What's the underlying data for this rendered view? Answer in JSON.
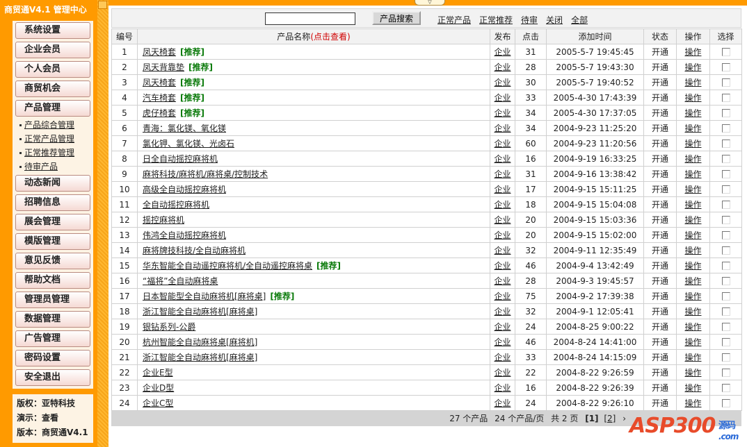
{
  "sidebar": {
    "title": "商贸通V4.1 管理中心",
    "menu": [
      "系统设置",
      "企业会员",
      "个人会员",
      "商贸机会",
      "产品管理"
    ],
    "submenu": [
      "产品综合管理",
      "正常产品管理",
      "正常推荐管理",
      "待审产品"
    ],
    "menu2": [
      "动态新闻",
      "招聘信息",
      "展会管理",
      "模版管理",
      "意见反馈",
      "帮助文档",
      "管理员管理",
      "数据管理",
      "广告管理",
      "密码设置",
      "安全退出"
    ],
    "info": [
      "版权：亚特科技",
      "演示：查看",
      "版本：商贸通V4.1"
    ]
  },
  "search": {
    "value": "",
    "button": "产品搜索",
    "filters": [
      "正常产品",
      "正常推荐",
      "待审",
      "关闭",
      "全部"
    ]
  },
  "table": {
    "headers": {
      "id": "编号",
      "name": "产品名称",
      "name_hint": "(点击查看)",
      "pub": "发布",
      "hits": "点击",
      "time": "添加时间",
      "status": "状态",
      "op": "操作",
      "sel": "选择"
    },
    "rec_label": "[推荐]",
    "rows": [
      {
        "id": "1",
        "name": "凤天椅套",
        "rec": true,
        "pub": "企业",
        "hits": "31",
        "time": "2005-5-7 19:45:45",
        "status": "开通",
        "op": "操作"
      },
      {
        "id": "2",
        "name": "凤天背靠垫",
        "rec": true,
        "pub": "企业",
        "hits": "28",
        "time": "2005-5-7 19:43:30",
        "status": "开通",
        "op": "操作"
      },
      {
        "id": "3",
        "name": "凤天椅套",
        "rec": true,
        "pub": "企业",
        "hits": "30",
        "time": "2005-5-7 19:40:52",
        "status": "开通",
        "op": "操作"
      },
      {
        "id": "4",
        "name": "汽车椅套",
        "rec": true,
        "pub": "企业",
        "hits": "33",
        "time": "2005-4-30 17:43:39",
        "status": "开通",
        "op": "操作"
      },
      {
        "id": "5",
        "name": "虎仔椅套",
        "rec": true,
        "pub": "企业",
        "hits": "34",
        "time": "2005-4-30 17:37:05",
        "status": "开通",
        "op": "操作"
      },
      {
        "id": "6",
        "name": "青海：氯化镁、氧化镁",
        "rec": false,
        "pub": "企业",
        "hits": "34",
        "time": "2004-9-23 11:25:20",
        "status": "开通",
        "op": "操作"
      },
      {
        "id": "7",
        "name": "氯化钾、氯化镁、光卤石",
        "rec": false,
        "pub": "企业",
        "hits": "60",
        "time": "2004-9-23 11:20:56",
        "status": "开通",
        "op": "操作"
      },
      {
        "id": "8",
        "name": "日全自动摇控麻将机",
        "rec": false,
        "pub": "企业",
        "hits": "16",
        "time": "2004-9-19 16:33:25",
        "status": "开通",
        "op": "操作"
      },
      {
        "id": "9",
        "name": "麻将科技/麻将机/麻将桌/控制技术",
        "rec": false,
        "pub": "企业",
        "hits": "31",
        "time": "2004-9-16 13:38:42",
        "status": "开通",
        "op": "操作"
      },
      {
        "id": "10",
        "name": "高级全自动摇控麻将机",
        "rec": false,
        "pub": "企业",
        "hits": "17",
        "time": "2004-9-15 15:11:25",
        "status": "开通",
        "op": "操作"
      },
      {
        "id": "11",
        "name": "全自动摇控麻将机",
        "rec": false,
        "pub": "企业",
        "hits": "18",
        "time": "2004-9-15 15:04:08",
        "status": "开通",
        "op": "操作"
      },
      {
        "id": "12",
        "name": "摇控麻将机",
        "rec": false,
        "pub": "企业",
        "hits": "20",
        "time": "2004-9-15 15:03:36",
        "status": "开通",
        "op": "操作"
      },
      {
        "id": "13",
        "name": "伟鸿全自动摇控麻将机",
        "rec": false,
        "pub": "企业",
        "hits": "20",
        "time": "2004-9-15 15:02:00",
        "status": "开通",
        "op": "操作"
      },
      {
        "id": "14",
        "name": "麻将牌技科技/全自动麻将机",
        "rec": false,
        "pub": "企业",
        "hits": "32",
        "time": "2004-9-11 12:35:49",
        "status": "开通",
        "op": "操作"
      },
      {
        "id": "15",
        "name": "华东智能全自动遥控麻将机/全自动遥控麻将桌",
        "rec": true,
        "pub": "企业",
        "hits": "46",
        "time": "2004-9-4 13:42:49",
        "status": "开通",
        "op": "操作"
      },
      {
        "id": "16",
        "name": "“福将”全自动麻将桌",
        "rec": false,
        "pub": "企业",
        "hits": "28",
        "time": "2004-9-3 19:45:57",
        "status": "开通",
        "op": "操作"
      },
      {
        "id": "17",
        "name": "日本智能型全自动麻将机[麻将桌]",
        "rec": true,
        "pub": "企业",
        "hits": "75",
        "time": "2004-9-2 17:39:38",
        "status": "开通",
        "op": "操作"
      },
      {
        "id": "18",
        "name": "浙江智能全自动麻将机[麻将桌]",
        "rec": false,
        "pub": "企业",
        "hits": "32",
        "time": "2004-9-1 12:05:41",
        "status": "开通",
        "op": "操作"
      },
      {
        "id": "19",
        "name": "银钻系列-公爵",
        "rec": false,
        "pub": "企业",
        "hits": "24",
        "time": "2004-8-25 9:00:22",
        "status": "开通",
        "op": "操作"
      },
      {
        "id": "20",
        "name": "杭州智能全自动麻将桌[麻将机]",
        "rec": false,
        "pub": "企业",
        "hits": "46",
        "time": "2004-8-24 14:41:00",
        "status": "开通",
        "op": "操作"
      },
      {
        "id": "21",
        "name": "浙江智能全自动麻将机[麻将桌]",
        "rec": false,
        "pub": "企业",
        "hits": "33",
        "time": "2004-8-24 14:15:09",
        "status": "开通",
        "op": "操作"
      },
      {
        "id": "22",
        "name": "企业E型",
        "rec": false,
        "pub": "企业",
        "hits": "22",
        "time": "2004-8-22 9:26:59",
        "status": "开通",
        "op": "操作"
      },
      {
        "id": "23",
        "name": "企业D型",
        "rec": false,
        "pub": "企业",
        "hits": "16",
        "time": "2004-8-22 9:26:39",
        "status": "开通",
        "op": "操作"
      },
      {
        "id": "24",
        "name": "企业C型",
        "rec": false,
        "pub": "企业",
        "hits": "24",
        "time": "2004-8-22 9:26:10",
        "status": "开通",
        "op": "操作"
      }
    ]
  },
  "pager": {
    "total": "27 个产品",
    "per_page": "24 个产品/页",
    "pages": "共 2 页",
    "page1": "[1]",
    "page2": "[2]",
    "next": "›"
  },
  "watermark": {
    "text": "ASP300",
    "cn": "源码",
    "com": ".com"
  }
}
